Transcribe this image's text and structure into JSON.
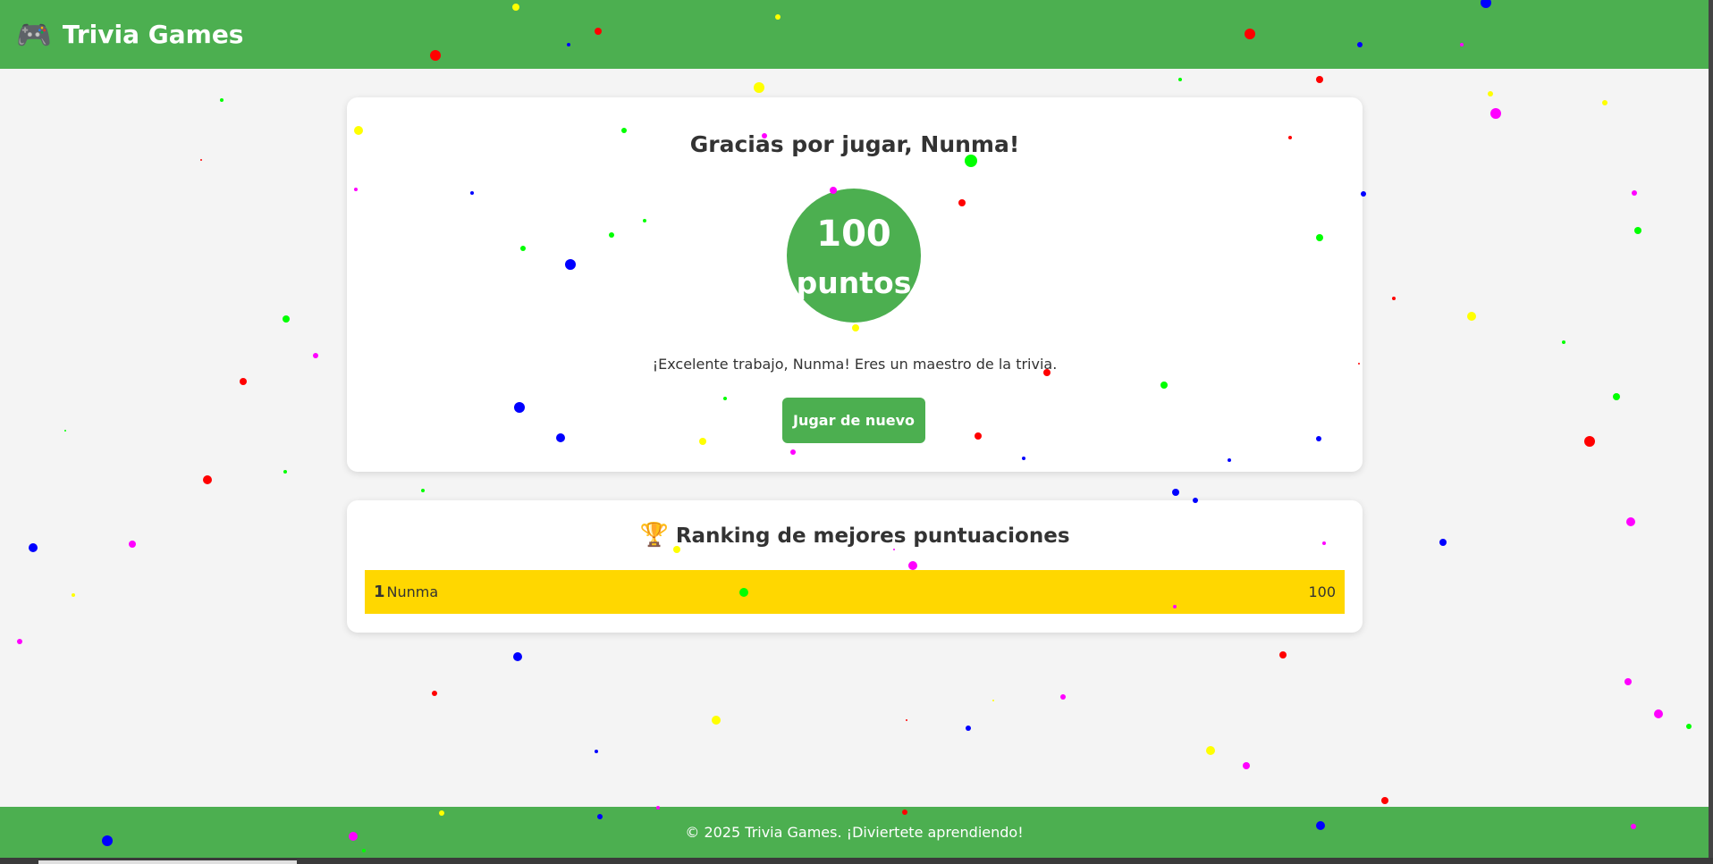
{
  "header": {
    "logo_icon": "🎮",
    "title": "Trivia Games"
  },
  "results": {
    "title": "Gracias por jugar, Nunma!",
    "score_value": "100",
    "score_unit": "puntos",
    "message": "¡Excelente trabajo, Nunma! Eres un maestro de la trivia.",
    "play_again_label": "Jugar de nuevo"
  },
  "ranking": {
    "trophy_icon": "🏆",
    "title": "Ranking de mejores puntuaciones",
    "entries": [
      {
        "position": "1",
        "name": "Nunma",
        "score": "100"
      }
    ]
  },
  "footer": {
    "text": "© 2025 Trivia Games. ¡Diviertete aprendiendo!"
  },
  "colors": {
    "primary_green": "#4caf50",
    "gold": "#ffd700",
    "background": "#f4f4f4"
  }
}
